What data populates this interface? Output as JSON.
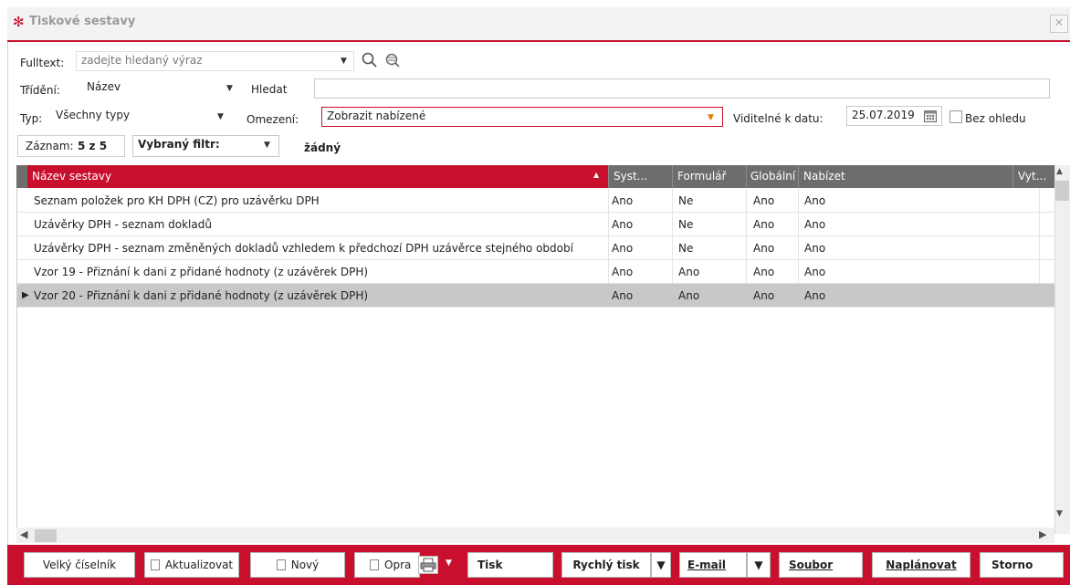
{
  "window": {
    "title": "Tiskové sestavy",
    "close_glyph": "✕"
  },
  "filters": {
    "fulltext_label": "Fulltext:",
    "fulltext_placeholder": "zadejte hledaný výraz",
    "sort_label": "Třídění:",
    "sort_value": "Název",
    "search_label": "Hledat",
    "search_value": "",
    "type_label": "Typ:",
    "type_value": "Všechny typy",
    "restrict_label": "Omezení:",
    "restrict_value": "Zobrazit nabízené",
    "visible_date_label": "Viditelné k datu:",
    "visible_date_value": "25.07.2019",
    "ignore_label": "Bez ohledu",
    "record_label": "Záznam:",
    "record_value": "5 z 5",
    "selected_filter_label": "Vybraný filtr:",
    "selected_filter_value": "žádný"
  },
  "table": {
    "columns": [
      "Název sestavy",
      "Syst...",
      "Formulář",
      "Globální",
      "Nabízet",
      "Vyt..."
    ],
    "rows": [
      [
        "Seznam položek pro KH DPH (CZ) pro uzávěrku DPH",
        "Ano",
        "Ne",
        "Ano",
        "Ano"
      ],
      [
        "Uzávěrky DPH - seznam dokladů",
        "Ano",
        "Ne",
        "Ano",
        "Ano"
      ],
      [
        "Uzávěrky DPH - seznam změněných dokladů vzhledem k předchozí DPH uzávěrce stejného období",
        "Ano",
        "Ne",
        "Ano",
        "Ano"
      ],
      [
        "Vzor 19 - Přiznání k dani z přidané hodnoty (z uzávěrek DPH)",
        "Ano",
        "Ano",
        "Ano",
        "Ano"
      ],
      [
        "Vzor 20 - Přiznání k dani z přidané hodnoty (z uzávěrek DPH)",
        "Ano",
        "Ano",
        "Ano",
        "Ano"
      ]
    ],
    "selected_row_index": 4
  },
  "footer": {
    "big_list": "Velký číselník",
    "refresh": "Aktualizovat",
    "new": "Nový",
    "edit": "Opra",
    "print": "Tisk",
    "quick_print": "Rychlý tisk",
    "email": "E-mail",
    "file": "Soubor",
    "schedule": "Naplánovat",
    "cancel": "Storno"
  },
  "colors": {
    "accent": "#c8102e",
    "header_gray": "#6d6d6d",
    "selected_row": "#c8c8c8"
  }
}
